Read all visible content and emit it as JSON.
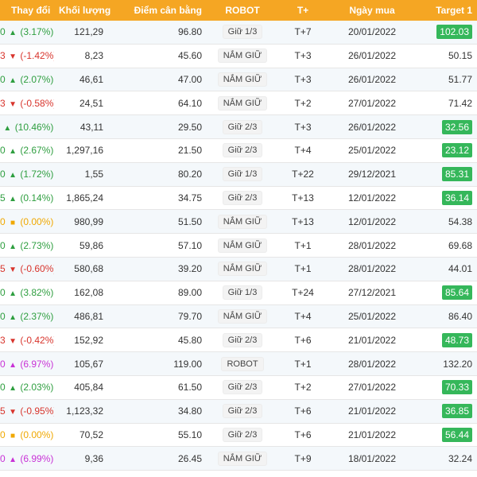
{
  "header": {
    "change": "Thay đổi",
    "volume": "Khối lượng",
    "balance": "Điểm cân bằng",
    "robot": "ROBOT",
    "tplus": "T+",
    "buy_date": "Ngày mua",
    "target1": "Target 1"
  },
  "colors": {
    "header_bg": "#f5a623",
    "up": "#2e9e3f",
    "down": "#d8342c",
    "flat": "#f0a800",
    "ceiling": "#c832d6",
    "target_badge": "#35b75a"
  },
  "rows": [
    {
      "prefix": "0",
      "dir": "up",
      "sym": "▲",
      "change": "(3.17%)",
      "volume": "121,29",
      "balance": "96.80",
      "robot": "Giữ 1/3",
      "tplus": "T+7",
      "date": "20/01/2022",
      "target": "102.03",
      "hit": true
    },
    {
      "prefix": "3",
      "dir": "down",
      "sym": "▼",
      "change": "(-1.42%)",
      "volume": "8,23",
      "balance": "45.60",
      "robot": "NẮM GIỮ",
      "tplus": "T+3",
      "date": "26/01/2022",
      "target": "50.15",
      "hit": false
    },
    {
      "prefix": "0",
      "dir": "up",
      "sym": "▲",
      "change": "(2.07%)",
      "volume": "46,61",
      "balance": "47.00",
      "robot": "NẮM GIỮ",
      "tplus": "T+3",
      "date": "26/01/2022",
      "target": "51.77",
      "hit": false
    },
    {
      "prefix": "3",
      "dir": "down",
      "sym": "▼",
      "change": "(-0.58%)",
      "volume": "24,51",
      "balance": "64.10",
      "robot": "NẮM GIỮ",
      "tplus": "T+2",
      "date": "27/01/2022",
      "target": "71.42",
      "hit": false
    },
    {
      "prefix": "",
      "dir": "up",
      "sym": "▲",
      "change": "(10.46%)",
      "volume": "43,11",
      "balance": "29.50",
      "robot": "Giữ 2/3",
      "tplus": "T+3",
      "date": "26/01/2022",
      "target": "32.56",
      "hit": true
    },
    {
      "prefix": "0",
      "dir": "up",
      "sym": "▲",
      "change": "(2.67%)",
      "volume": "1,297,16",
      "balance": "21.50",
      "robot": "Giữ 2/3",
      "tplus": "T+4",
      "date": "25/01/2022",
      "target": "23.12",
      "hit": true
    },
    {
      "prefix": "0",
      "dir": "up",
      "sym": "▲",
      "change": "(1.72%)",
      "volume": "1,55",
      "balance": "80.20",
      "robot": "Giữ 1/3",
      "tplus": "T+22",
      "date": "29/12/2021",
      "target": "85.31",
      "hit": true
    },
    {
      "prefix": "5",
      "dir": "up",
      "sym": "▲",
      "change": "(0.14%)",
      "volume": "1,865,24",
      "balance": "34.75",
      "robot": "Giữ 2/3",
      "tplus": "T+13",
      "date": "12/01/2022",
      "target": "36.14",
      "hit": true
    },
    {
      "prefix": "0",
      "dir": "flat",
      "sym": "■",
      "change": "(0.00%)",
      "volume": "980,99",
      "balance": "51.50",
      "robot": "NẮM GIỮ",
      "tplus": "T+13",
      "date": "12/01/2022",
      "target": "54.38",
      "hit": false
    },
    {
      "prefix": "0",
      "dir": "up",
      "sym": "▲",
      "change": "(2.73%)",
      "volume": "59,86",
      "balance": "57.10",
      "robot": "NẮM GIỮ",
      "tplus": "T+1",
      "date": "28/01/2022",
      "target": "69.68",
      "hit": false
    },
    {
      "prefix": "5",
      "dir": "down",
      "sym": "▼",
      "change": "(-0.60%)",
      "volume": "580,68",
      "balance": "39.20",
      "robot": "NẮM GIỮ",
      "tplus": "T+1",
      "date": "28/01/2022",
      "target": "44.01",
      "hit": false
    },
    {
      "prefix": "0",
      "dir": "up",
      "sym": "▲",
      "change": "(3.82%)",
      "volume": "162,08",
      "balance": "89.00",
      "robot": "Giữ 1/3",
      "tplus": "T+24",
      "date": "27/12/2021",
      "target": "85.64",
      "hit": true
    },
    {
      "prefix": "0",
      "dir": "up",
      "sym": "▲",
      "change": "(2.37%)",
      "volume": "486,81",
      "balance": "79.70",
      "robot": "NẮM GIỮ",
      "tplus": "T+4",
      "date": "25/01/2022",
      "target": "86.40",
      "hit": false
    },
    {
      "prefix": "3",
      "dir": "down",
      "sym": "▼",
      "change": "(-0.42%)",
      "volume": "152,92",
      "balance": "45.80",
      "robot": "Giữ 2/3",
      "tplus": "T+6",
      "date": "21/01/2022",
      "target": "48.73",
      "hit": true
    },
    {
      "prefix": "0",
      "dir": "ceil",
      "sym": "▲",
      "change": "(6.97%)",
      "volume": "105,67",
      "balance": "119.00",
      "robot": "ROBOT",
      "tplus": "T+1",
      "date": "28/01/2022",
      "target": "132.20",
      "hit": false
    },
    {
      "prefix": "0",
      "dir": "up",
      "sym": "▲",
      "change": "(2.03%)",
      "volume": "405,84",
      "balance": "61.50",
      "robot": "Giữ 2/3",
      "tplus": "T+2",
      "date": "27/01/2022",
      "target": "70.33",
      "hit": true
    },
    {
      "prefix": "5",
      "dir": "down",
      "sym": "▼",
      "change": "(-0.95%)",
      "volume": "1,123,32",
      "balance": "34.80",
      "robot": "Giữ 2/3",
      "tplus": "T+6",
      "date": "21/01/2022",
      "target": "36.85",
      "hit": true
    },
    {
      "prefix": "0",
      "dir": "flat",
      "sym": "■",
      "change": "(0.00%)",
      "volume": "70,52",
      "balance": "55.10",
      "robot": "Giữ 2/3",
      "tplus": "T+6",
      "date": "21/01/2022",
      "target": "56.44",
      "hit": true
    },
    {
      "prefix": "0",
      "dir": "ceil",
      "sym": "▲",
      "change": "(6.99%)",
      "volume": "9,36",
      "balance": "26.45",
      "robot": "NẮM GIỮ",
      "tplus": "T+9",
      "date": "18/01/2022",
      "target": "32.24",
      "hit": false
    }
  ]
}
